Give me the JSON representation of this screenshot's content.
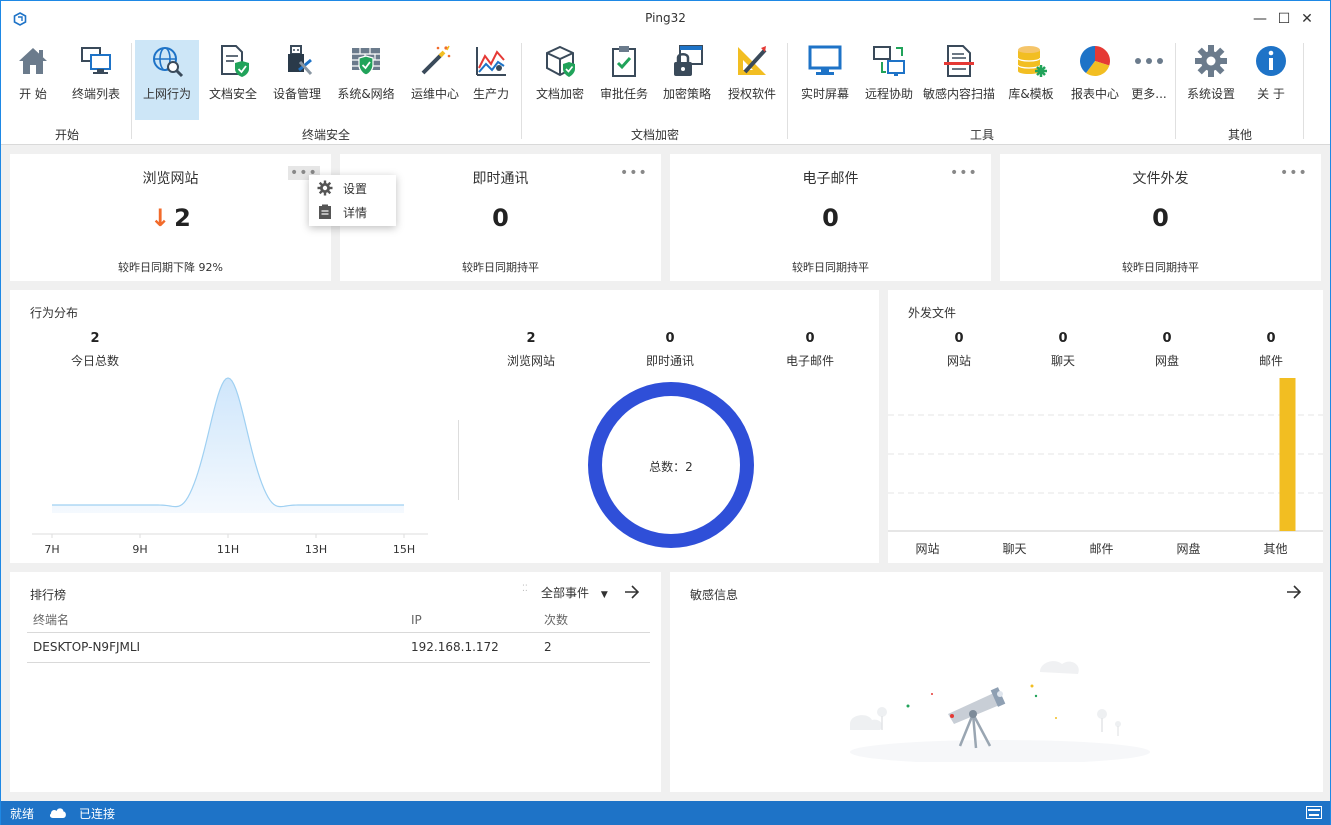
{
  "window": {
    "title": "Ping32",
    "min": "—",
    "max": "☐",
    "close": "✕"
  },
  "ribbon": {
    "buttons": [
      {
        "id": "start",
        "label": "开 始"
      },
      {
        "id": "terminals",
        "label": "终端列表"
      },
      {
        "id": "web",
        "label": "上网行为"
      },
      {
        "id": "docsec",
        "label": "文档安全"
      },
      {
        "id": "device",
        "label": "设备管理"
      },
      {
        "id": "sysnet",
        "label": "系统&网络"
      },
      {
        "id": "ops",
        "label": "运维中心"
      },
      {
        "id": "prod",
        "label": "生产力"
      },
      {
        "id": "docenc",
        "label": "文档加密"
      },
      {
        "id": "approve",
        "label": "审批任务"
      },
      {
        "id": "encpolicy",
        "label": "加密策略"
      },
      {
        "id": "license",
        "label": "授权软件"
      },
      {
        "id": "screen",
        "label": "实时屏幕"
      },
      {
        "id": "remote",
        "label": "远程协助"
      },
      {
        "id": "scan",
        "label": "敏感内容扫描"
      },
      {
        "id": "lib",
        "label": "库&模板"
      },
      {
        "id": "report",
        "label": "报表中心"
      },
      {
        "id": "more",
        "label": "更多..."
      },
      {
        "id": "settings",
        "label": "系统设置"
      },
      {
        "id": "about",
        "label": "关 于"
      }
    ],
    "groups": [
      "开始",
      "终端安全",
      "文档加密",
      "工具",
      "其他"
    ]
  },
  "cards": [
    {
      "title": "浏览网站",
      "value": "2",
      "trend": "↓",
      "sub": "较昨日同期下降 92%"
    },
    {
      "title": "即时通讯",
      "value": "0",
      "sub": "较昨日同期持平"
    },
    {
      "title": "电子邮件",
      "value": "0",
      "sub": "较昨日同期持平"
    },
    {
      "title": "文件外发",
      "value": "0",
      "sub": "较昨日同期持平"
    }
  ],
  "context_menu": {
    "items": [
      "设置",
      "详情"
    ]
  },
  "behavior": {
    "title": "行为分布",
    "today_count": "2",
    "today_label": "今日总数",
    "stats": [
      {
        "value": "2",
        "label": "浏览网站"
      },
      {
        "value": "0",
        "label": "即时通讯"
      },
      {
        "value": "0",
        "label": "电子邮件"
      }
    ],
    "donut_label": "总数：2"
  },
  "outgoing": {
    "title": "外发文件",
    "stats": [
      {
        "value": "0",
        "label": "网站"
      },
      {
        "value": "0",
        "label": "聊天"
      },
      {
        "value": "0",
        "label": "网盘"
      },
      {
        "value": "0",
        "label": "邮件"
      }
    ]
  },
  "ranking": {
    "title": "排行榜",
    "filter": "全部事件",
    "columns": [
      "终端名",
      "IP",
      "次数"
    ],
    "rows": [
      {
        "name": "DESKTOP-N9FJMLI",
        "ip": "192.168.1.172",
        "count": "2"
      }
    ]
  },
  "sensitive": {
    "title": "敏感信息"
  },
  "statusbar": {
    "ready": "就绪",
    "connected": "已连接"
  },
  "colors": {
    "accent": "#1e73c7",
    "donut": "#2f4fd8",
    "bar": "#f2be22",
    "down_arrow": "#f26b2b"
  },
  "chart_data": [
    {
      "type": "area",
      "title": "",
      "x": [
        "7H",
        "9H",
        "11H",
        "13H",
        "15H"
      ],
      "series": [
        {
          "values": [
            0,
            0,
            2,
            0,
            0
          ]
        }
      ],
      "ylim": [
        0,
        2
      ],
      "grid": false
    },
    {
      "type": "pie",
      "title": "",
      "categories": [
        "浏览网站",
        "即时通讯",
        "电子邮件"
      ],
      "values": [
        2,
        0,
        0
      ],
      "center_label": "总数：2"
    },
    {
      "type": "bar",
      "title": "",
      "categories": [
        "网站",
        "聊天",
        "邮件",
        "网盘",
        "其他"
      ],
      "values": [
        0,
        0,
        0,
        0,
        1
      ],
      "grid": true
    }
  ]
}
